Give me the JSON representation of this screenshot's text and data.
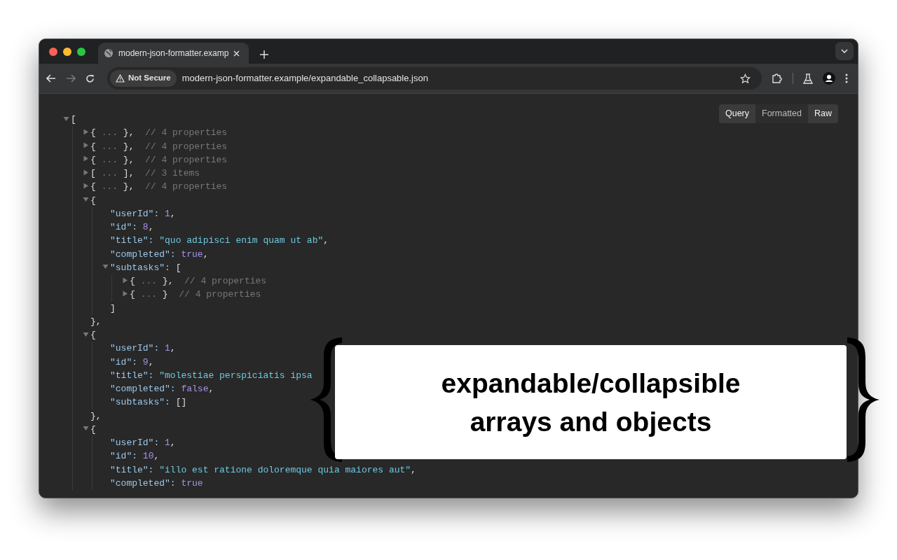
{
  "browser": {
    "tab": {
      "title": "modern-json-formatter.examp"
    },
    "nav": {
      "forward_enabled": false
    },
    "address": {
      "security": "Not Secure",
      "url": "modern-json-formatter.example/expandable_collapsable.json"
    }
  },
  "view_modes": [
    {
      "label": "Query",
      "selected": false
    },
    {
      "label": "Formatted",
      "selected": true
    },
    {
      "label": "Raw",
      "selected": false
    }
  ],
  "json_tree": {
    "kind": "branch",
    "expanded": true,
    "open": "[",
    "children": [
      {
        "kind": "branch",
        "expanded": false,
        "open": "{",
        "ellipsis": "...",
        "close": "},",
        "comment": "// 4 properties"
      },
      {
        "kind": "branch",
        "expanded": false,
        "open": "{",
        "ellipsis": "...",
        "close": "},",
        "comment": "// 4 properties"
      },
      {
        "kind": "branch",
        "expanded": false,
        "open": "{",
        "ellipsis": "...",
        "close": "},",
        "comment": "// 4 properties"
      },
      {
        "kind": "branch",
        "expanded": false,
        "open": "[",
        "ellipsis": "...",
        "close": "],",
        "comment": "// 3 items"
      },
      {
        "kind": "branch",
        "expanded": false,
        "open": "{",
        "ellipsis": "...",
        "close": "},",
        "comment": "// 4 properties"
      },
      {
        "kind": "branch",
        "expanded": true,
        "open": "{",
        "close": "},",
        "children": [
          {
            "kind": "number",
            "key": "\"userId\":",
            "value": "1",
            "tail": ","
          },
          {
            "kind": "number",
            "key": "\"id\":",
            "value": "8",
            "tail": ","
          },
          {
            "kind": "string",
            "key": "\"title\":",
            "value": "\"quo adipisci enim quam ut ab\"",
            "tail": ","
          },
          {
            "kind": "boolean",
            "key": "\"completed\":",
            "value": "true",
            "tail": ","
          },
          {
            "kind": "branch",
            "expanded": true,
            "key": "\"subtasks\":",
            "open": "[",
            "close": "]",
            "children": [
              {
                "kind": "branch",
                "expanded": false,
                "open": "{",
                "ellipsis": "...",
                "close": "},",
                "comment": "// 4 properties"
              },
              {
                "kind": "branch",
                "expanded": false,
                "open": "{",
                "ellipsis": "...",
                "close": "}",
                "comment": "// 4 properties"
              }
            ]
          }
        ]
      },
      {
        "kind": "branch",
        "expanded": true,
        "open": "{",
        "close": "},",
        "children": [
          {
            "kind": "number",
            "key": "\"userId\":",
            "value": "1",
            "tail": ","
          },
          {
            "kind": "number",
            "key": "\"id\":",
            "value": "9",
            "tail": ","
          },
          {
            "kind": "string",
            "key": "\"title\":",
            "value": "\"molestiae perspiciatis ipsa"
          },
          {
            "kind": "boolean",
            "key": "\"completed\":",
            "value": "false",
            "tail": ","
          },
          {
            "kind": "punctuation",
            "key": "\"subtasks\":",
            "value": "[]"
          }
        ]
      },
      {
        "kind": "branch",
        "expanded": true,
        "open": "{",
        "children": [
          {
            "kind": "number",
            "key": "\"userId\":",
            "value": "1",
            "tail": ","
          },
          {
            "kind": "number",
            "key": "\"id\":",
            "value": "10",
            "tail": ","
          },
          {
            "kind": "string",
            "key": "\"title\":",
            "value": "\"illo est ratione doloremque quia maiores aut\"",
            "tail": ","
          },
          {
            "kind": "boolean",
            "key": "\"completed\":",
            "value": "true"
          }
        ]
      }
    ]
  },
  "callout": {
    "lines": [
      "expandable/collapsible",
      "arrays and objects"
    ]
  }
}
